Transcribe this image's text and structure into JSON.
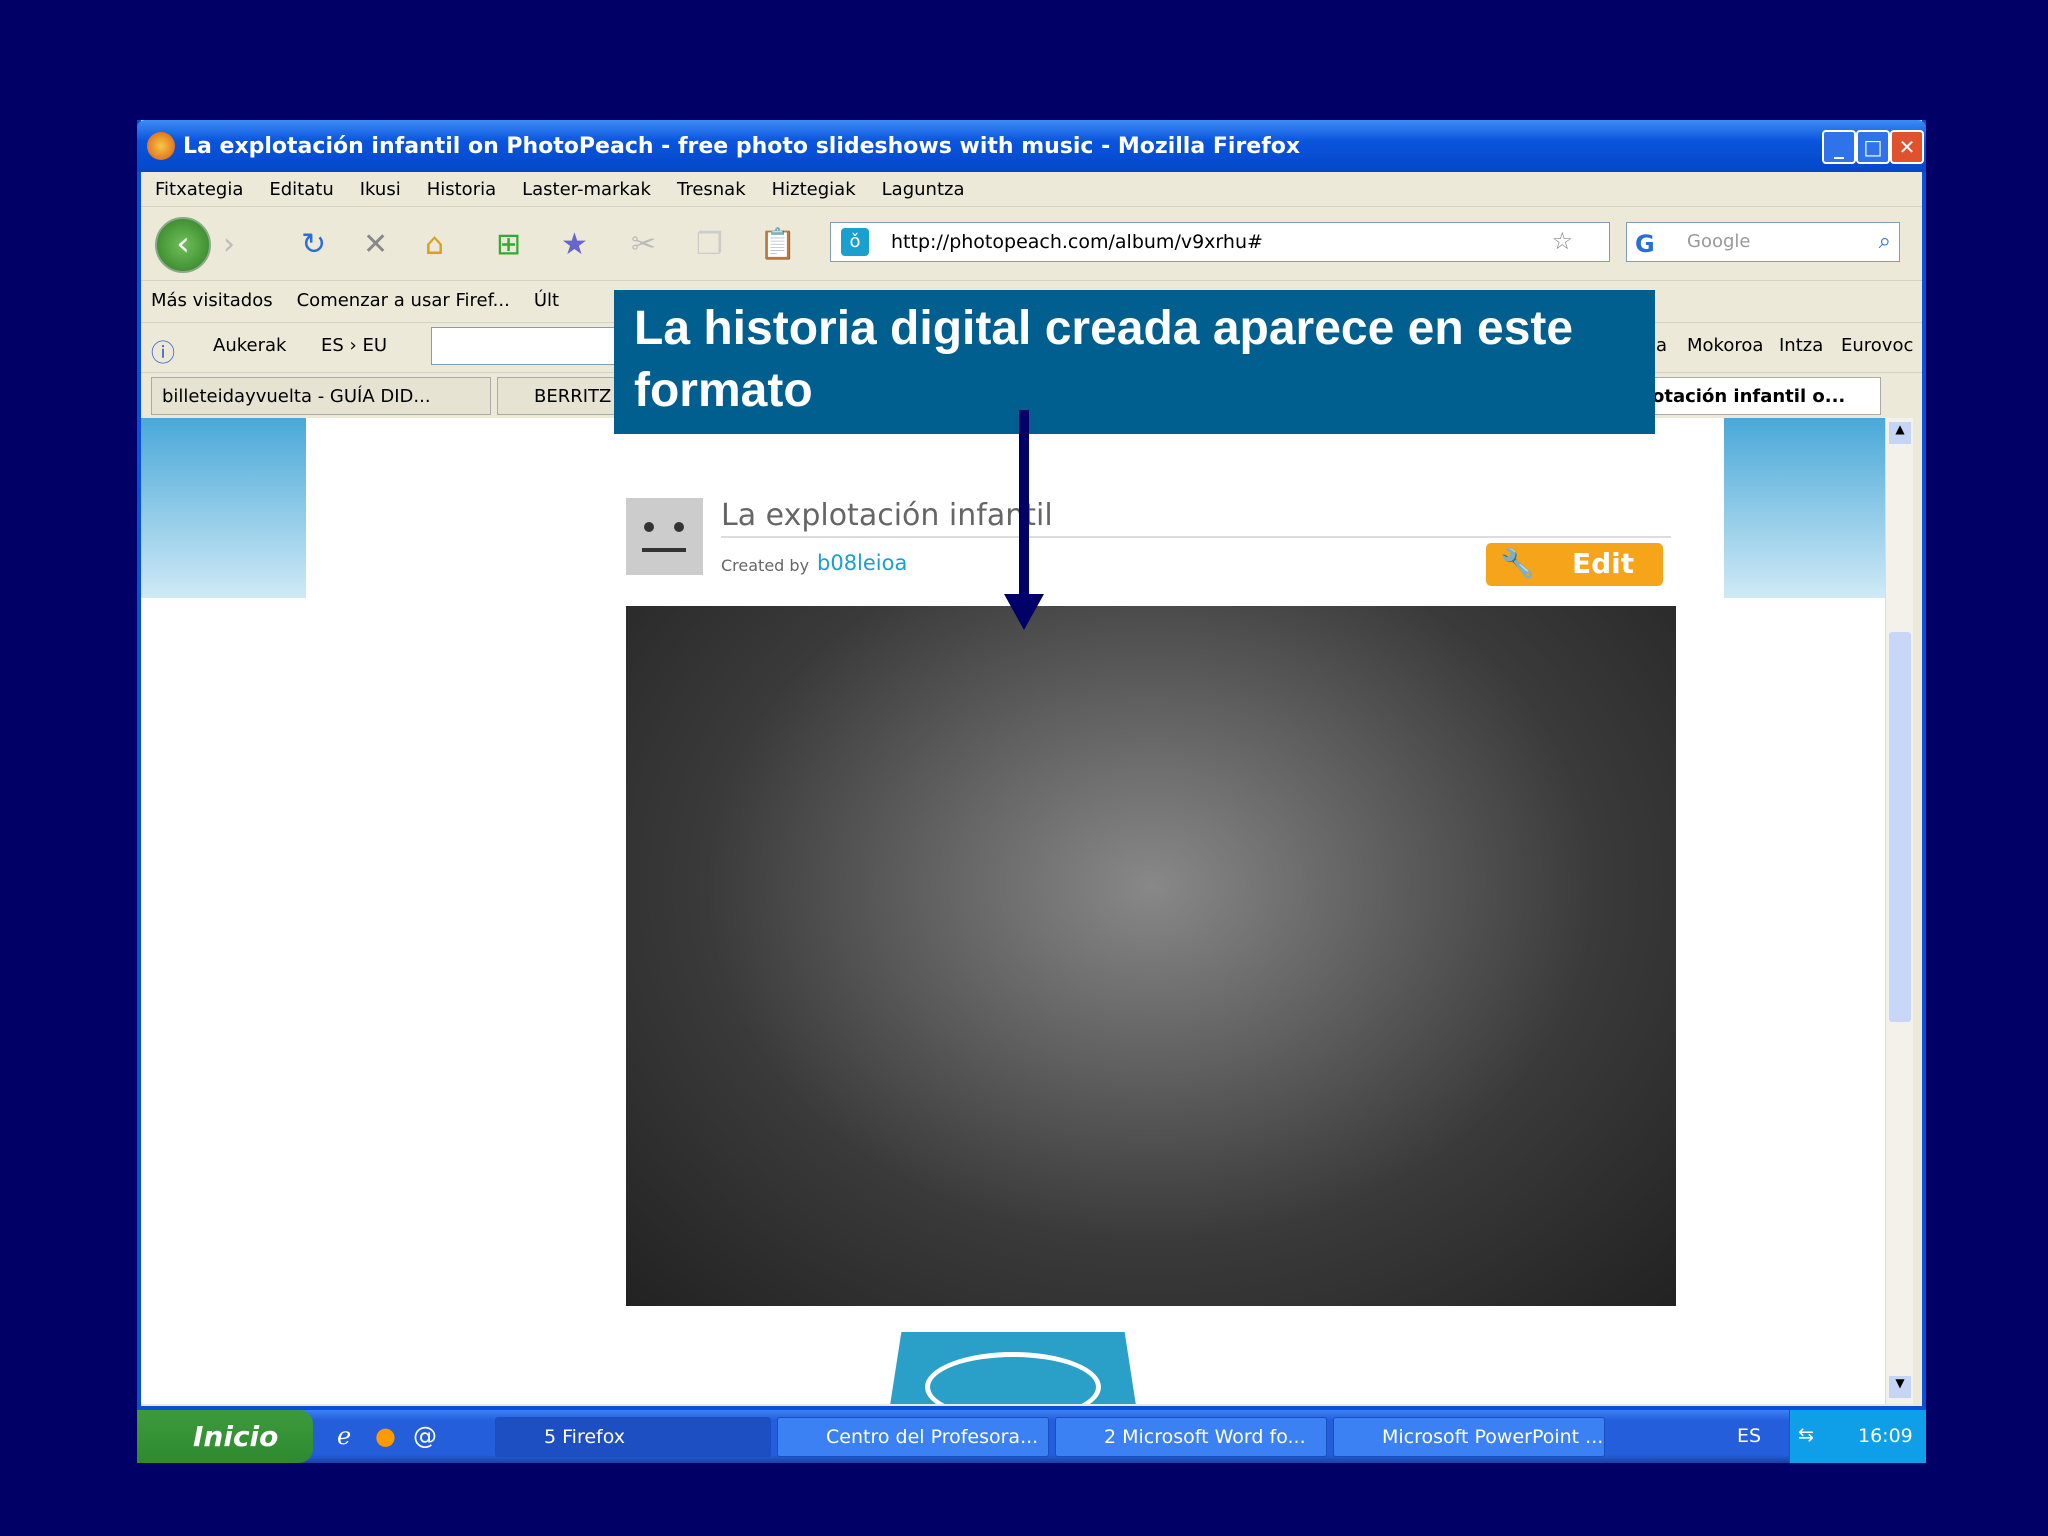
{
  "window": {
    "title": "La explotación infantil on PhotoPeach - free photo slideshows with music - Mozilla Firefox"
  },
  "menu": [
    "Fitxategia",
    "Editatu",
    "Ikusi",
    "Historia",
    "Laster-markak",
    "Tresnak",
    "Hiztegiak",
    "Laguntza"
  ],
  "url": "http://photopeach.com/album/v9xrhu#",
  "search_placeholder": "Google",
  "bookmarks": [
    "Más visitados",
    "Comenzar a usar Firef...",
    "Últ"
  ],
  "dictbar": {
    "left": [
      "Aukerak",
      "ES › EU"
    ],
    "right": [
      "ia",
      "Mokoroa",
      "Intza",
      "Eurovoc"
    ]
  },
  "tabs": [
    "billeteidayvuelta - GUÍA DID...",
    "BERRITZ",
    "otación infantil o..."
  ],
  "page": {
    "album_title": "La explotación infantil",
    "created_by": "Created by",
    "author": "b08leioa",
    "edit": "Edit"
  },
  "overlay": {
    "text": "La historia digital creada aparece en este formato"
  },
  "taskbar": {
    "start": "Inicio",
    "tasks": [
      "5 Firefox",
      "Centro del Profesora...",
      "2 Microsoft Word fo...",
      "Microsoft PowerPoint ..."
    ],
    "lang": "ES",
    "time": "16:09"
  }
}
